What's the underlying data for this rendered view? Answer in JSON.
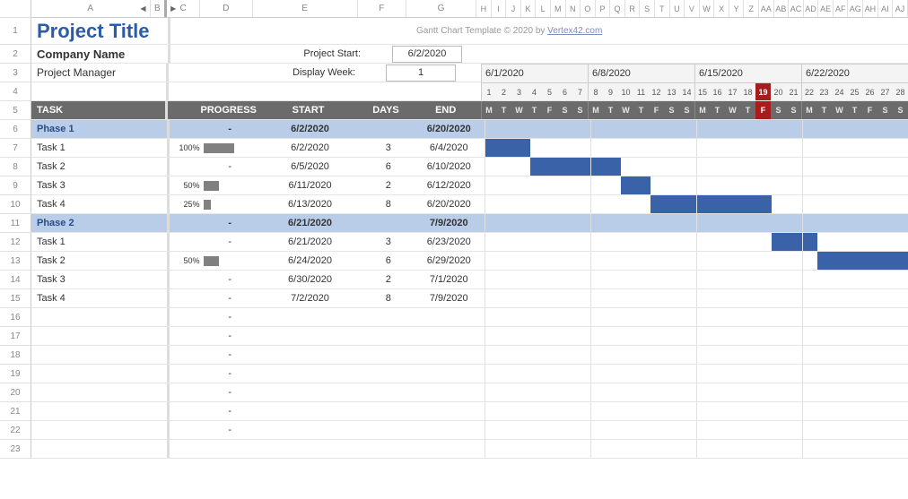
{
  "columns_wide": [
    "A",
    "B",
    "C",
    "D",
    "E",
    "F",
    "G"
  ],
  "columns_narrow": [
    "H",
    "I",
    "J",
    "K",
    "L",
    "M",
    "N",
    "O",
    "P",
    "Q",
    "R",
    "S",
    "T",
    "U",
    "V",
    "W",
    "X",
    "Y",
    "Z",
    "AA",
    "AB",
    "AC",
    "AD",
    "AE",
    "AF",
    "AG",
    "AH",
    "AI",
    "AJ"
  ],
  "row_numbers": [
    1,
    2,
    3,
    4,
    5,
    6,
    7,
    8,
    9,
    10,
    11,
    12,
    13,
    14,
    15,
    16,
    17,
    18,
    19,
    20,
    21,
    22,
    23
  ],
  "title": "Project Title",
  "company": "Company Name",
  "manager": "Project Manager",
  "labels": {
    "project_start": "Project Start:",
    "display_week": "Display Week:"
  },
  "start_value": "6/2/2020",
  "display_week_value": "1",
  "attribution": {
    "prefix": "Gantt Chart Template © 2020 by ",
    "link": "Vertex42.com"
  },
  "weeks": [
    "6/1/2020",
    "6/8/2020",
    "6/15/2020",
    "6/22/2020"
  ],
  "day_nums": [
    1,
    2,
    3,
    4,
    5,
    6,
    7,
    8,
    9,
    10,
    11,
    12,
    13,
    14,
    15,
    16,
    17,
    18,
    19,
    20,
    21,
    22,
    23,
    24,
    25,
    26,
    27,
    28
  ],
  "dow": [
    "M",
    "T",
    "W",
    "T",
    "F",
    "S",
    "S",
    "M",
    "T",
    "W",
    "T",
    "F",
    "S",
    "S",
    "M",
    "T",
    "W",
    "T",
    "F",
    "S",
    "S",
    "M",
    "T",
    "W",
    "T",
    "F",
    "S",
    "S"
  ],
  "today_index": 18,
  "header": {
    "task": "TASK",
    "progress": "PROGRESS",
    "start": "START",
    "days": "DAYS",
    "end": "END"
  },
  "rows": [
    {
      "type": "phase",
      "task": "Phase 1",
      "progress_text": "-",
      "start": "6/2/2020",
      "days": "",
      "end": "6/20/2020",
      "bar_start": 1,
      "bar_end": 19,
      "color": "light"
    },
    {
      "type": "task",
      "task": "Task 1",
      "pct": "100%",
      "pct_w": 34,
      "progress_text": "",
      "start": "6/2/2020",
      "days": "3",
      "end": "6/4/2020",
      "bar_start": 1,
      "bar_end": 3,
      "color": "blue"
    },
    {
      "type": "task",
      "task": "Task 2",
      "pct": "",
      "pct_w": 0,
      "progress_text": "-",
      "start": "6/5/2020",
      "days": "6",
      "end": "6/10/2020",
      "bar_start": 4,
      "bar_end": 9,
      "color": "blue"
    },
    {
      "type": "task",
      "task": "Task 3",
      "pct": "50%",
      "pct_w": 17,
      "progress_text": "",
      "start": "6/11/2020",
      "days": "2",
      "end": "6/12/2020",
      "bar_start": 10,
      "bar_end": 11,
      "color": "blue"
    },
    {
      "type": "task",
      "task": "Task 4",
      "pct": "25%",
      "pct_w": 8,
      "progress_text": "",
      "start": "6/13/2020",
      "days": "8",
      "end": "6/20/2020",
      "bar_start": 12,
      "bar_end": 19,
      "color": "blue"
    },
    {
      "type": "phase",
      "task": "Phase 2",
      "progress_text": "-",
      "start": "6/21/2020",
      "days": "",
      "end": "7/9/2020",
      "bar_start": 20,
      "bar_end": 28,
      "color": "light"
    },
    {
      "type": "task",
      "task": "Task 1",
      "pct": "",
      "pct_w": 0,
      "progress_text": "-",
      "start": "6/21/2020",
      "days": "3",
      "end": "6/23/2020",
      "bar_start": 20,
      "bar_end": 22,
      "color": "blue"
    },
    {
      "type": "task",
      "task": "Task 2",
      "pct": "50%",
      "pct_w": 17,
      "progress_text": "",
      "start": "6/24/2020",
      "days": "6",
      "end": "6/29/2020",
      "bar_start": 23,
      "bar_end": 28,
      "color": "blue"
    },
    {
      "type": "task",
      "task": "Task 3",
      "pct": "",
      "pct_w": 0,
      "progress_text": "-",
      "start": "6/30/2020",
      "days": "2",
      "end": "7/1/2020",
      "bar_start": -1,
      "bar_end": -1,
      "color": "blue"
    },
    {
      "type": "task",
      "task": "Task 4",
      "pct": "",
      "pct_w": 0,
      "progress_text": "-",
      "start": "7/2/2020",
      "days": "8",
      "end": "7/9/2020",
      "bar_start": -1,
      "bar_end": -1,
      "color": "blue"
    },
    {
      "type": "empty",
      "progress_text": "-"
    },
    {
      "type": "empty",
      "progress_text": "-"
    },
    {
      "type": "empty",
      "progress_text": "-"
    },
    {
      "type": "empty",
      "progress_text": "-"
    },
    {
      "type": "empty",
      "progress_text": "-"
    },
    {
      "type": "empty",
      "progress_text": "-"
    },
    {
      "type": "empty",
      "progress_text": "-"
    },
    {
      "type": "empty",
      "progress_text": ""
    }
  ]
}
